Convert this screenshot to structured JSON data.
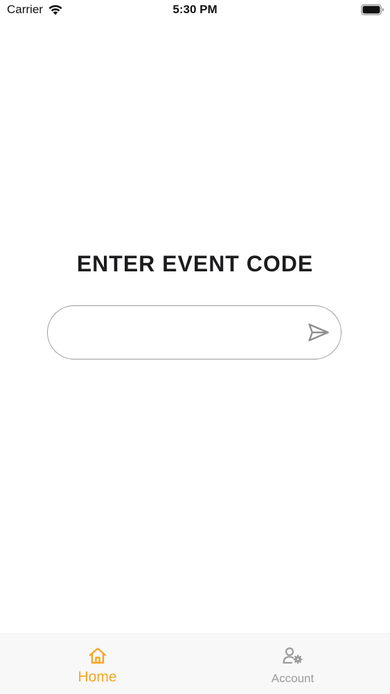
{
  "status_bar": {
    "carrier": "Carrier",
    "time": "5:30 PM",
    "wifi_icon": "wifi-icon",
    "battery_icon": "battery-icon"
  },
  "main": {
    "title": "ENTER EVENT CODE",
    "code_input": {
      "value": "",
      "placeholder": ""
    },
    "send_icon": "send-icon"
  },
  "tab_bar": {
    "tabs": [
      {
        "label": "Home",
        "icon": "home-icon",
        "active": true
      },
      {
        "label": "Account",
        "icon": "user-settings-icon",
        "active": false
      }
    ]
  },
  "colors": {
    "accent": "#f5a623",
    "inactive": "#9b9b9b",
    "title": "#1c1c1e",
    "field_border": "#9a9a9a",
    "tab_bar_bg": "#f8f8f8"
  }
}
